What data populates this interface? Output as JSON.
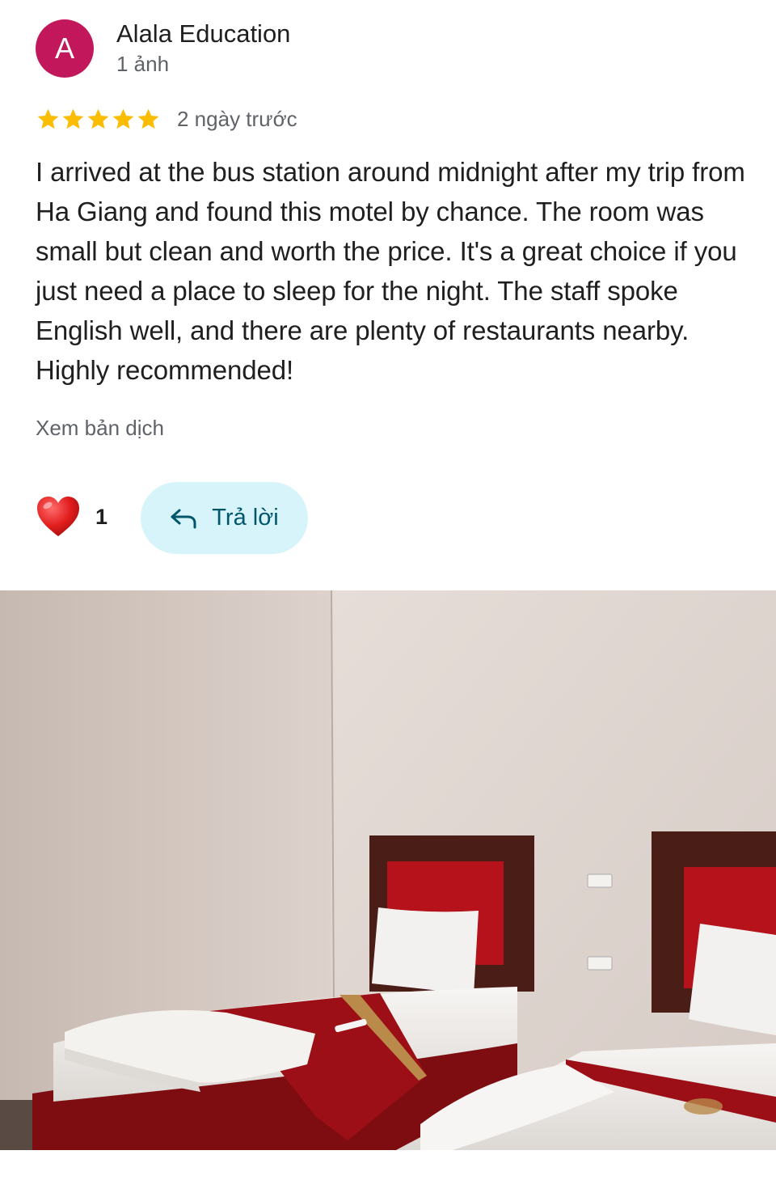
{
  "review": {
    "avatar_letter": "A",
    "avatar_color": "#c2185b",
    "author_name": "Alala Education",
    "author_meta": "1 ảnh",
    "rating": 5,
    "star_color": "#fbbc04",
    "date": "2 ngày trước",
    "text": "I arrived at the bus station around midnight after my trip from Ha Giang and found this motel by chance. The room was small but clean and worth the price. It's a great choice if you just need a place to sleep for the night. The staff spoke English well, and there are plenty of restaurants nearby. Highly recommended!",
    "translate_label": "Xem bản dịch"
  },
  "actions": {
    "heart_icon": "heart-icon",
    "like_count": "1",
    "reply_icon": "reply-arrow-icon",
    "reply_label": "Trả lời",
    "reply_bg": "#d7f4fb"
  },
  "photo": {
    "subject": "hotel-room-photo"
  }
}
